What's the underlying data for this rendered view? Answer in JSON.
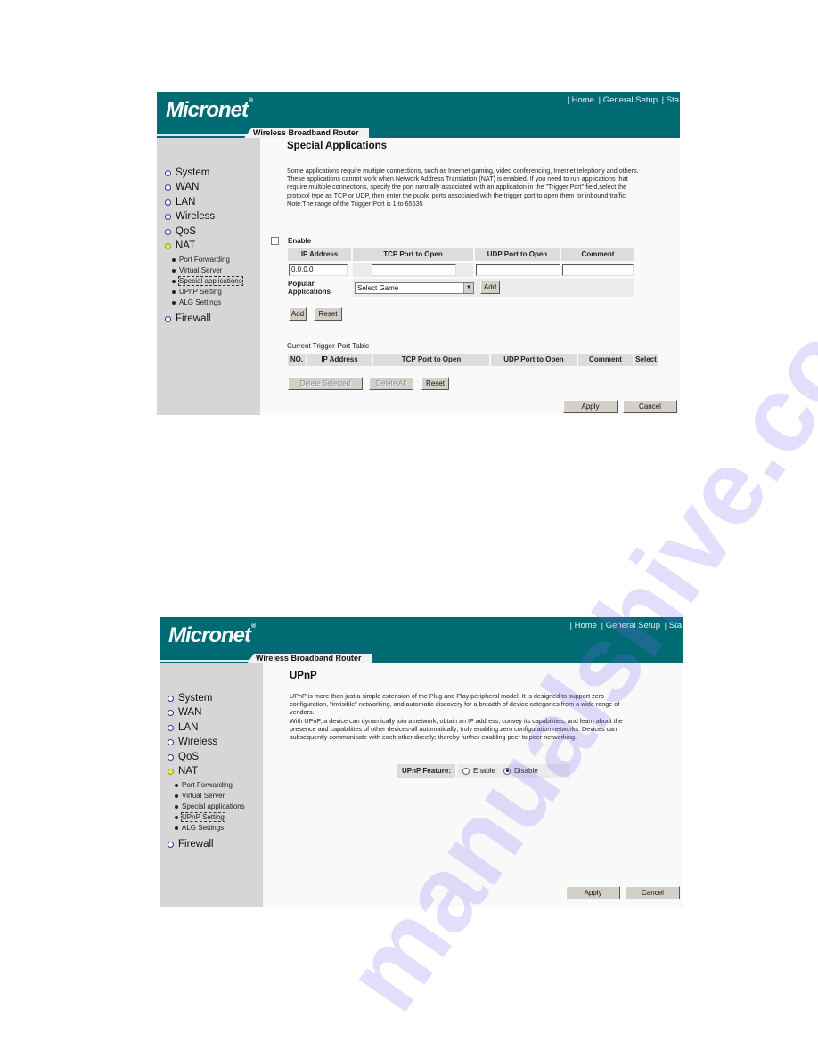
{
  "common": {
    "brand": "Micronet",
    "brand_mark": "®",
    "product_tag": "Wireless Broadband Router",
    "top_nav": [
      "| Home",
      "| General Setup",
      "| Sta"
    ],
    "sidebar": {
      "items": [
        {
          "label": "System"
        },
        {
          "label": "WAN"
        },
        {
          "label": "LAN"
        },
        {
          "label": "Wireless"
        },
        {
          "label": "QoS"
        },
        {
          "label": "NAT",
          "active": true
        },
        {
          "label": "Firewall"
        }
      ],
      "nat_sub_items": [
        "Port Forwarding",
        "Virtual Server",
        "Special applications",
        "UPnP Setting",
        "ALG Settings"
      ]
    },
    "colors": {
      "header": "#006b73",
      "sidebar": "#d6d6d6",
      "content": "#f9f9f9"
    }
  },
  "special_apps": {
    "selected_sub_item": "Special applications",
    "title": "Special Applications",
    "description": [
      "Some applications require multiple connections, such as Internet gaming, video conferencing, Internet telephony and others.",
      "These applications cannot work when Network Address Translation (NAT) is enabled. If you need to run applications that",
      "require multiple connections, specify the port normally associated with an application in the \"Trigger Port\" field,select the",
      "protocol type as TCP or UDP, then enter the public ports associated with the trigger port to open them for inbound traffic.",
      "Note:The range of the Trigger Port is 1 to 65535"
    ],
    "enable_label": "Enable",
    "enable_checked": false,
    "form_headers": [
      "IP Address",
      "TCP Port to Open",
      "UDP Port to Open",
      "Comment"
    ],
    "ip_value": "0.0.0.0",
    "tcp_value": "",
    "udp_value": "",
    "comment_value": "",
    "popular_label": "Popular Applications",
    "popular_select": "Select Game",
    "popular_add": "Add",
    "add_label": "Add",
    "reset_label": "Reset",
    "table_title": "Current Trigger-Port Table",
    "table_headers": [
      "NO.",
      "IP Address",
      "TCP Port to Open",
      "UDP Port to Open",
      "Comment",
      "Select"
    ],
    "table_rows": [],
    "delete_selected": "Delete Selected",
    "delete_all": "Delete All",
    "table_reset": "Reset",
    "apply": "Apply",
    "cancel": "Cancel"
  },
  "upnp": {
    "selected_sub_item": "UPnP Setting",
    "title": "UPnP",
    "description": [
      "UPnP is more than just a simple extension of the Plug and Play peripheral model. It is designed to support zero-",
      "configuration, \"invisible\" networking, and automatic discovery for a breadth of device categories from a wide range of",
      "vendors.",
      "With UPnP, a device can dynamically join a network, obtain an IP address, convey its capabilities, and learn about the",
      "presence and capabilities of other devices-all automatically; truly enabling zero configuration networks. Devices can",
      "subsequently communicate with each other directly; thereby further enabling peer to peer networking."
    ],
    "feature_label": "UPnP Feature:",
    "enable_label": "Enable",
    "disable_label": "Disable",
    "selected": "Disable",
    "apply": "Apply",
    "cancel": "Cancel"
  },
  "watermark": "manualshive.com"
}
